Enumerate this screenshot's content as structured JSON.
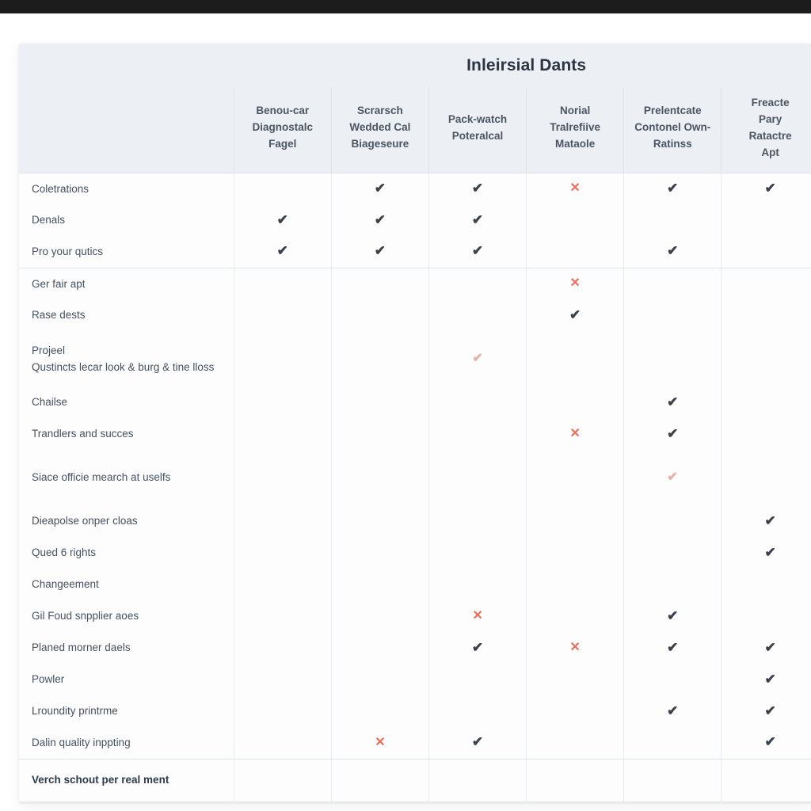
{
  "window": {
    "titlebar_color": "#1c1c1c",
    "page_background": "#ffffff"
  },
  "card": {
    "title": "Inleirsial Dants",
    "header_background": "#eceff4",
    "accent_check": "#3b414a",
    "accent_cross": "#e8705a",
    "accent_check_faint": "#e6b2a0"
  },
  "columns": [
    {
      "id": "col-label",
      "label": ""
    },
    {
      "id": "col-1",
      "label": "Benou-car Diagnostalc Fagel"
    },
    {
      "id": "col-2",
      "label": "Scrarsch Wedded Cal Biageseure"
    },
    {
      "id": "col-3",
      "label": "Pack-watch Poteralcal"
    },
    {
      "id": "col-4",
      "label": "Norial Tralrefiive Mataole"
    },
    {
      "id": "col-5",
      "label": "Prelentcate Contonel Own-Ratinss"
    },
    {
      "id": "col-6",
      "label": "Freacte Pary Ratactre Apt"
    }
  ],
  "column_lines": [
    [
      "Benou-car",
      "Diagnostalc",
      "Fagel"
    ],
    [
      "Scrarsch",
      "Wedded Cal",
      "Biageseure"
    ],
    [
      "Pack-watch",
      "Poteralcal"
    ],
    [
      "Norial",
      "Tralrefiive",
      "Mataole"
    ],
    [
      "Prelentcate",
      "Contonel Own-",
      "Ratinss"
    ],
    [
      "Freacte",
      "Pary",
      "Ratactre",
      "Apt"
    ]
  ],
  "rows": [
    {
      "label": "Coletrations",
      "section_start": false,
      "tall": false,
      "bold": false,
      "marks": [
        "",
        "check",
        "check",
        "cross",
        "check",
        "check"
      ]
    },
    {
      "label": "Denals",
      "section_start": false,
      "tall": false,
      "bold": false,
      "marks": [
        "check",
        "check",
        "check",
        "",
        "",
        ""
      ]
    },
    {
      "label": "Pro your qutics",
      "section_start": false,
      "tall": false,
      "bold": false,
      "marks": [
        "check",
        "check",
        "check",
        "",
        "check",
        ""
      ]
    },
    {
      "label": "Ger fair apt",
      "section_start": true,
      "tall": false,
      "bold": false,
      "marks": [
        "",
        "",
        "",
        "cross",
        "",
        ""
      ]
    },
    {
      "label": "Rase dests",
      "section_start": false,
      "tall": false,
      "bold": false,
      "marks": [
        "",
        "",
        "",
        "check",
        "",
        ""
      ]
    },
    {
      "label": "Projeel\nQustincts lecar look & burg & tine lloss",
      "section_start": false,
      "tall": true,
      "bold": false,
      "marks": [
        "",
        "",
        "check-faint",
        "",
        "",
        ""
      ]
    },
    {
      "label": "Chailse",
      "section_start": false,
      "tall": false,
      "bold": false,
      "marks": [
        "",
        "",
        "",
        "",
        "check",
        ""
      ]
    },
    {
      "label": "Trandlers and succes",
      "section_start": false,
      "tall": false,
      "bold": false,
      "marks": [
        "",
        "",
        "",
        "cross",
        "check",
        ""
      ]
    },
    {
      "label": "Siace officie mearch at uselfs",
      "section_start": false,
      "tall": true,
      "bold": false,
      "marks": [
        "",
        "",
        "",
        "",
        "check-faint",
        ""
      ]
    },
    {
      "label": "Dieapolse onper cloas",
      "section_start": false,
      "tall": false,
      "bold": false,
      "marks": [
        "",
        "",
        "",
        "",
        "",
        "check"
      ]
    },
    {
      "label": "Qued 6 rights",
      "section_start": false,
      "tall": false,
      "bold": false,
      "marks": [
        "",
        "",
        "",
        "",
        "",
        "check"
      ]
    },
    {
      "label": "Changeement",
      "section_start": false,
      "tall": false,
      "bold": false,
      "marks": [
        "",
        "",
        "",
        "",
        "",
        ""
      ]
    },
    {
      "label": "Gil Foud snpplier aoes",
      "section_start": false,
      "tall": false,
      "bold": false,
      "marks": [
        "",
        "",
        "cross",
        "",
        "check",
        ""
      ]
    },
    {
      "label": "Planed morner daels",
      "section_start": false,
      "tall": false,
      "bold": false,
      "marks": [
        "",
        "",
        "check",
        "cross",
        "check",
        "check"
      ]
    },
    {
      "label": "Powler",
      "section_start": false,
      "tall": false,
      "bold": false,
      "marks": [
        "",
        "",
        "",
        "",
        "",
        "check"
      ]
    },
    {
      "label": "Lroundity printrme",
      "section_start": false,
      "tall": false,
      "bold": false,
      "marks": [
        "",
        "",
        "",
        "",
        "check",
        "check"
      ]
    },
    {
      "label": "Dalin quality inppting",
      "section_start": false,
      "tall": false,
      "bold": false,
      "marks": [
        "",
        "cross",
        "check",
        "",
        "",
        "check"
      ]
    },
    {
      "label": "Verch schout per real ment",
      "section_start": true,
      "tall": false,
      "bold": true,
      "marks": [
        "",
        "",
        "",
        "",
        "",
        ""
      ]
    }
  ],
  "mark_glyphs": {
    "check": "✔",
    "check-faint": "✔",
    "cross": "✕"
  }
}
